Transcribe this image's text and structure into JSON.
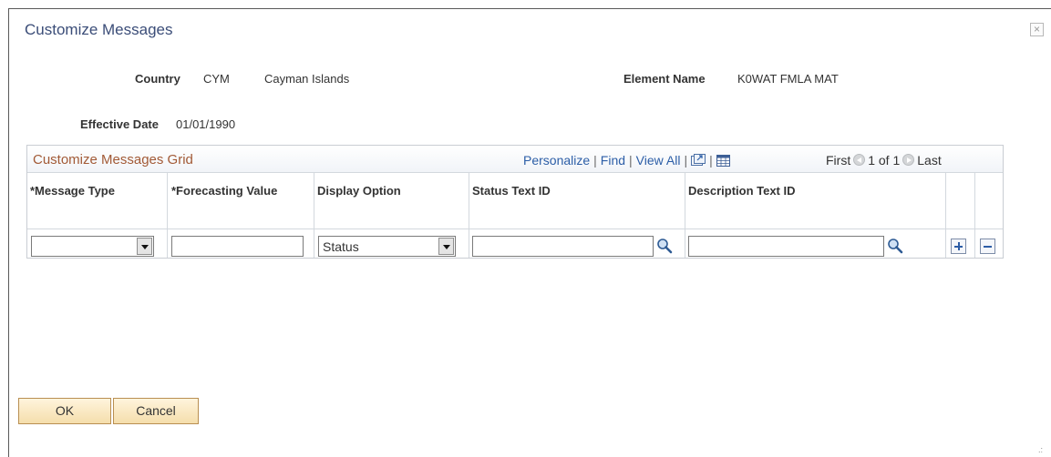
{
  "dialog": {
    "title": "Customize Messages",
    "close_symbol": "×"
  },
  "fields": {
    "country_label": "Country",
    "country_code": "CYM",
    "country_name": "Cayman Islands",
    "element_name_label": "Element Name",
    "element_name_value": "K0WAT FMLA MAT",
    "effective_date_label": "Effective Date",
    "effective_date_value": "01/01/1990"
  },
  "grid": {
    "title": "Customize Messages Grid",
    "nav": {
      "personalize": "Personalize",
      "find": "Find",
      "view_all": "View All",
      "sep": "|"
    },
    "pager": {
      "first": "First",
      "range": "1 of 1",
      "last": "Last"
    },
    "columns": [
      "*Message Type",
      "*Forecasting Value",
      "Display Option",
      "Status Text ID",
      "Description Text ID"
    ],
    "row": {
      "message_type": "",
      "forecasting_value": "",
      "display_option": "Status",
      "status_text_id": "",
      "description_text_id": ""
    }
  },
  "buttons": {
    "ok": "OK",
    "cancel": "Cancel"
  },
  "icons": [
    "close-icon",
    "zoom-icon",
    "spreadsheet-icon",
    "prev-arrow-icon",
    "next-arrow-icon",
    "lookup-icon",
    "add-row-icon",
    "delete-row-icon",
    "resize-grip-icon"
  ],
  "colors": {
    "title": "#3b4d78",
    "grid_title": "#a25a36",
    "link": "#2c5ea7",
    "button_fill": "#f5deac"
  }
}
